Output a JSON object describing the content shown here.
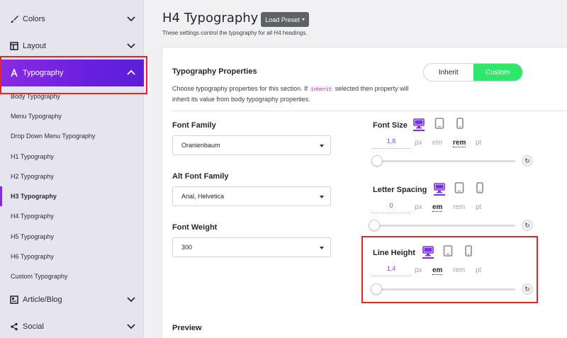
{
  "sidebar": {
    "sections": [
      {
        "label": "Colors",
        "icon": "brush-icon"
      },
      {
        "label": "Layout",
        "icon": "layout-icon"
      },
      {
        "label": "Typography",
        "icon": "typography-icon",
        "active": true
      },
      {
        "label": "Article/Blog",
        "icon": "article-icon"
      },
      {
        "label": "Social",
        "icon": "share-icon"
      }
    ],
    "typography_items": [
      "Body Typography",
      "Menu Typography",
      "Drop Down Menu Typography",
      "H1 Typography",
      "H2 Typography",
      "H3 Typography",
      "H4 Typography",
      "H5 Typography",
      "H6 Typography",
      "Custom Typography"
    ],
    "current_item": "H3 Typography"
  },
  "header": {
    "title": "H4 Typography",
    "load_preset": "Load Preset",
    "subtitle": "These settings control the typography for all H4 headings."
  },
  "properties": {
    "heading": "Typography Properties",
    "desc_before": "Choose typography properties for this section. If ",
    "desc_code": "inherit",
    "desc_after": " selected then property will inherit its value from body typography properties.",
    "toggle": {
      "inherit": "Inherit",
      "custom": "Custom",
      "selected": "Custom"
    }
  },
  "fields": {
    "font_family": {
      "label": "Font Family",
      "value": "Oranienbaum"
    },
    "alt_font_family": {
      "label": "Alt Font Family",
      "value": "Arial, Helvetica"
    },
    "font_weight": {
      "label": "Font Weight",
      "value": "300"
    }
  },
  "controls": {
    "units": [
      "px",
      "em",
      "rem",
      "pt"
    ],
    "font_size": {
      "label": "Font Size",
      "value": "1,8",
      "unit": "rem",
      "slider": 0
    },
    "letter_spacing": {
      "label": "Letter Spacing",
      "value": "0",
      "unit": "em",
      "slider": 0
    },
    "line_height": {
      "label": "Line Height",
      "value": "1,4",
      "unit": "em",
      "slider": 0
    }
  },
  "preview": {
    "label": "Preview"
  },
  "colors": {
    "accent": "#7b2fe0",
    "toggle_on": "#2ee86c",
    "highlight": "#e2262b"
  }
}
